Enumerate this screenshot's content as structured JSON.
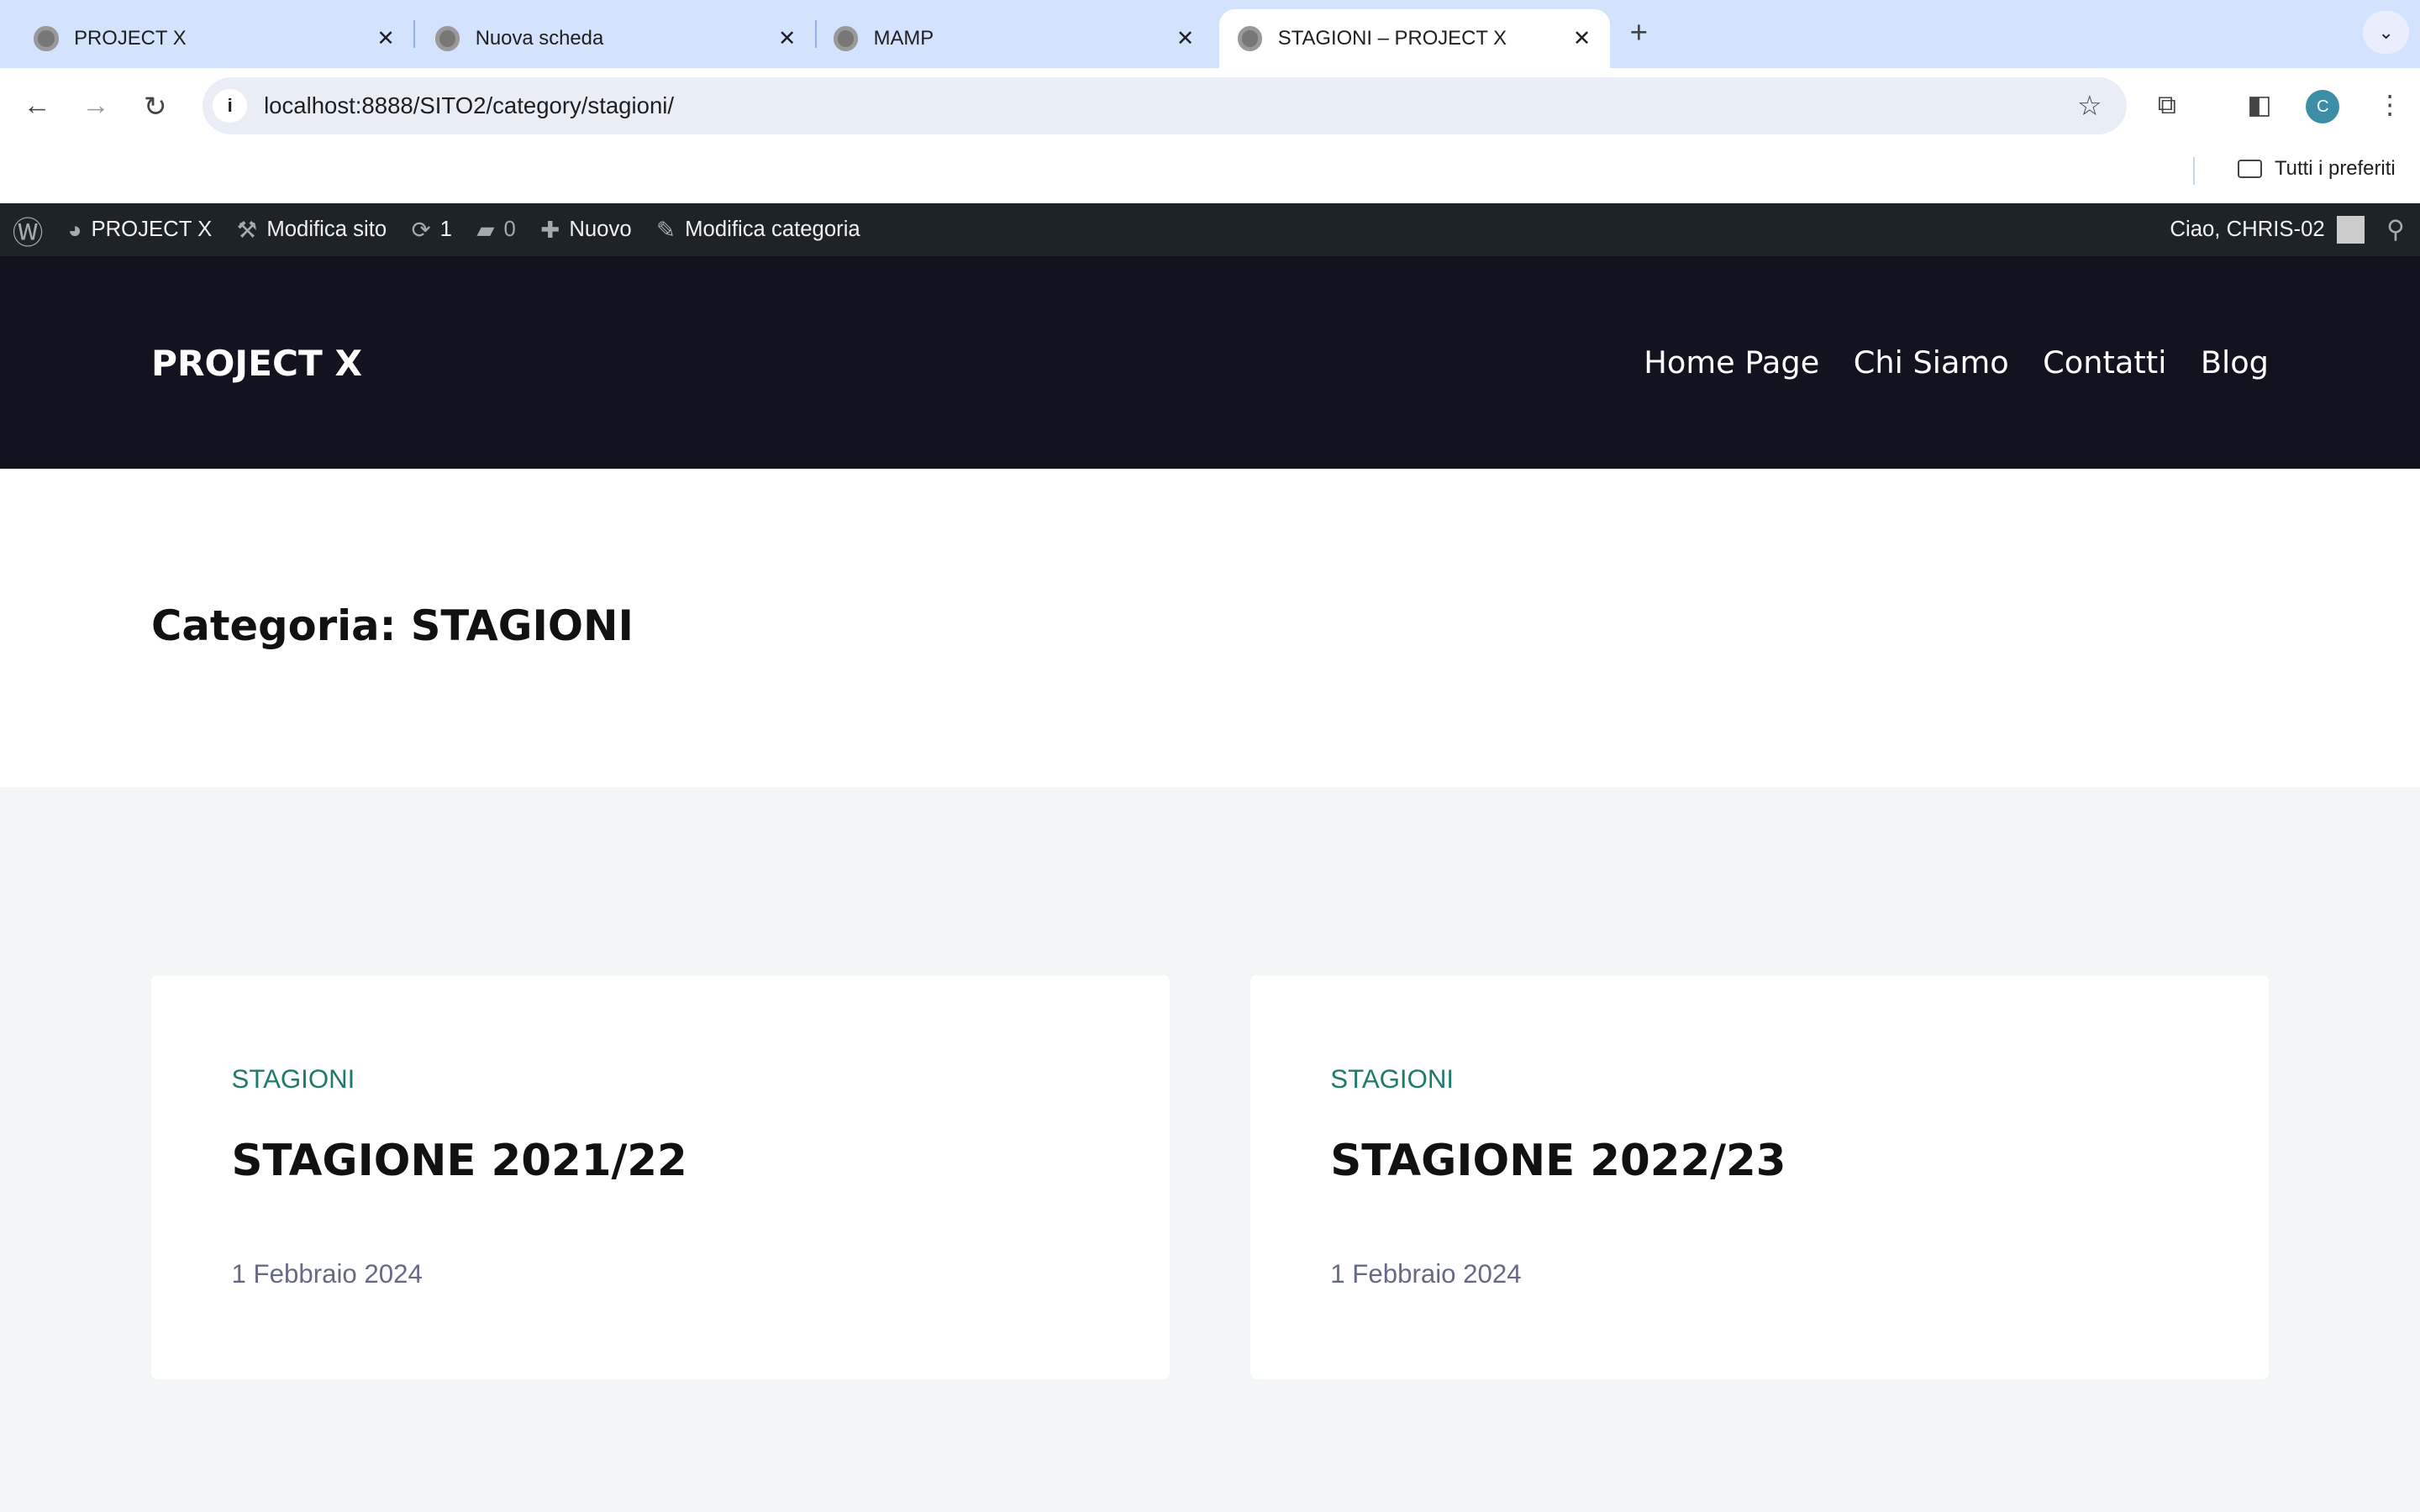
{
  "browser": {
    "tabs": [
      {
        "title": "PROJECT X",
        "active": false
      },
      {
        "title": "Nuova scheda",
        "active": false
      },
      {
        "title": "MAMP",
        "active": false
      },
      {
        "title": "STAGIONI – PROJECT X",
        "active": true
      }
    ],
    "url": "localhost:8888/SITO2/category/stagioni/",
    "bookmarks_label": "Tutti i preferiti",
    "profile_initial": "C"
  },
  "adminbar": {
    "site": "PROJECT X",
    "edit_site": "Modifica sito",
    "updates": "1",
    "comments": "0",
    "new": "Nuovo",
    "edit_category": "Modifica categoria",
    "greeting": "Ciao, CHRIS-02"
  },
  "site": {
    "logo": "PROJECT X",
    "menu": [
      "Home Page",
      "Chi Siamo",
      "Contatti",
      "Blog"
    ]
  },
  "archive": {
    "title": "Categoria: STAGIONI"
  },
  "posts": [
    {
      "category": "STAGIONI",
      "title": "STAGIONE 2021/22",
      "date": "1 Febbraio 2024"
    },
    {
      "category": "STAGIONI",
      "title": "STAGIONE 2022/23",
      "date": "1 Febbraio 2024"
    }
  ]
}
